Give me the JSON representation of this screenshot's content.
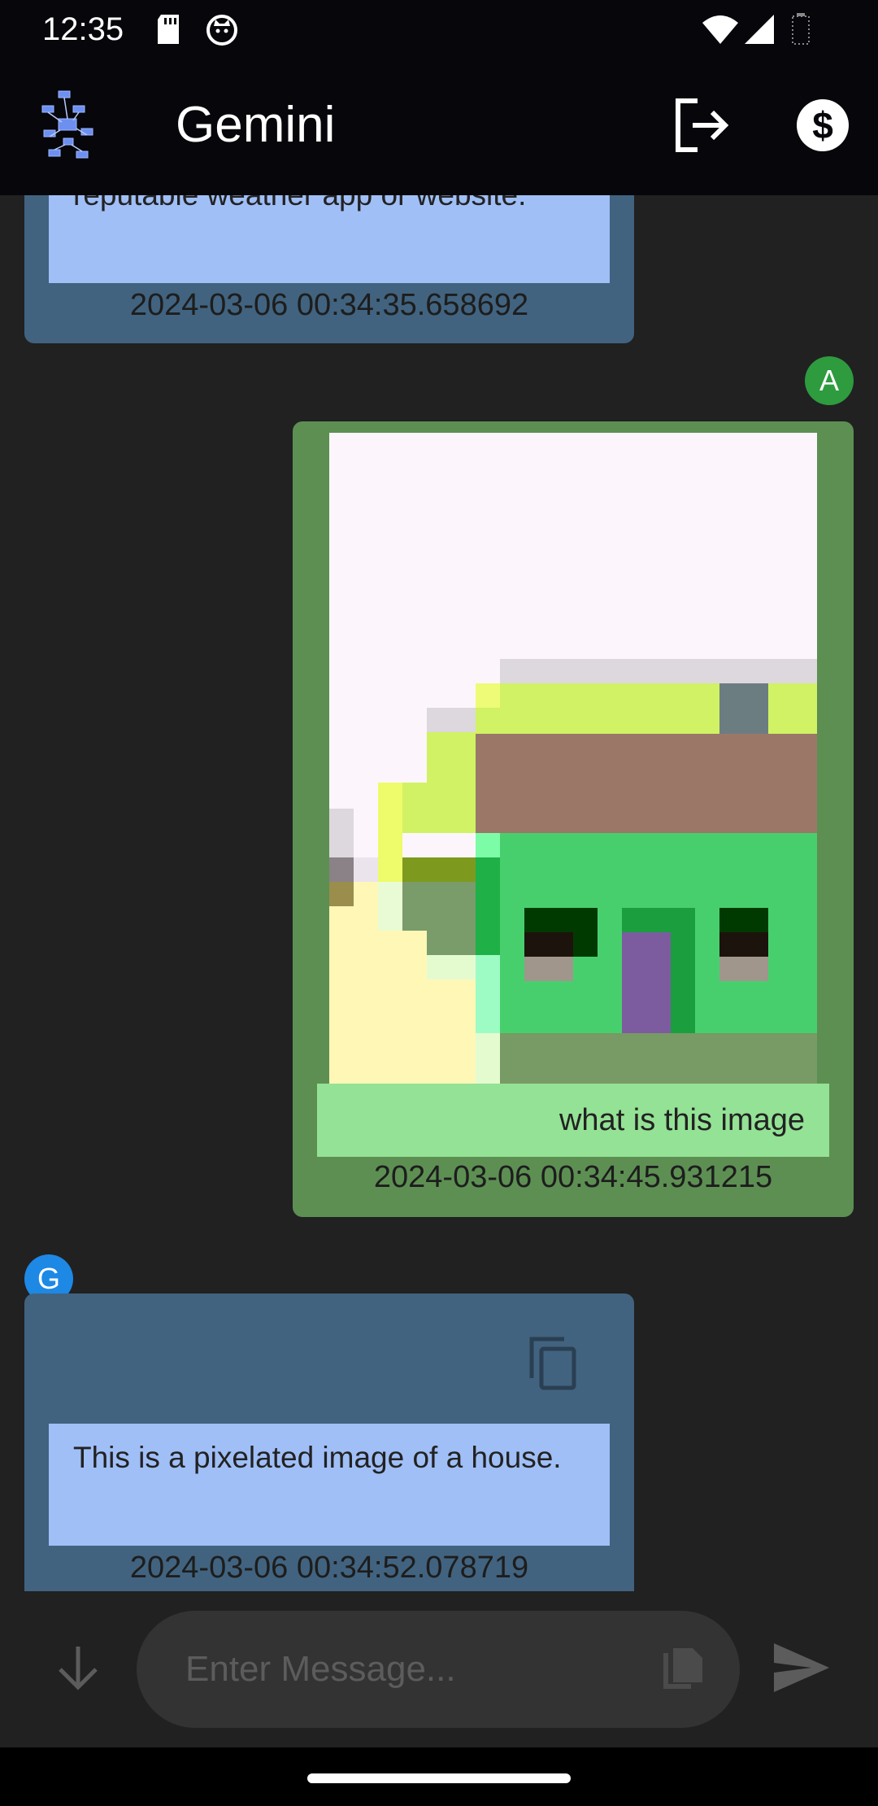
{
  "status_bar": {
    "time": "12:35"
  },
  "app_bar": {
    "title": "Gemini",
    "logo_icon": "network-cube-icon",
    "logout_icon": "logout-icon",
    "billing_icon": "dollar-circle-icon"
  },
  "messages": [
    {
      "sender": "G",
      "text": "reputable weather app or website.",
      "timestamp": "2024-03-06 00:34:35.658692"
    },
    {
      "sender": "A",
      "avatar": "A",
      "text": "what is this image",
      "timestamp": "2024-03-06 00:34:45.931215",
      "attachment": "pixelated house image"
    },
    {
      "sender": "G",
      "avatar": "G",
      "text": " This is a pixelated image of a house.",
      "timestamp": "2024-03-06 00:34:52.078719"
    }
  ],
  "composer": {
    "placeholder": "Enter Message..."
  },
  "colors": {
    "app_bar": "#06060b",
    "background": "#212121",
    "gemini_bubble": "#41637f",
    "gemini_text_box": "#a0bff7",
    "user_bubble": "#5d8f53",
    "user_text_box": "#94e295",
    "avatar_user": "#2e9b3f",
    "avatar_gemini": "#1e88e5"
  }
}
